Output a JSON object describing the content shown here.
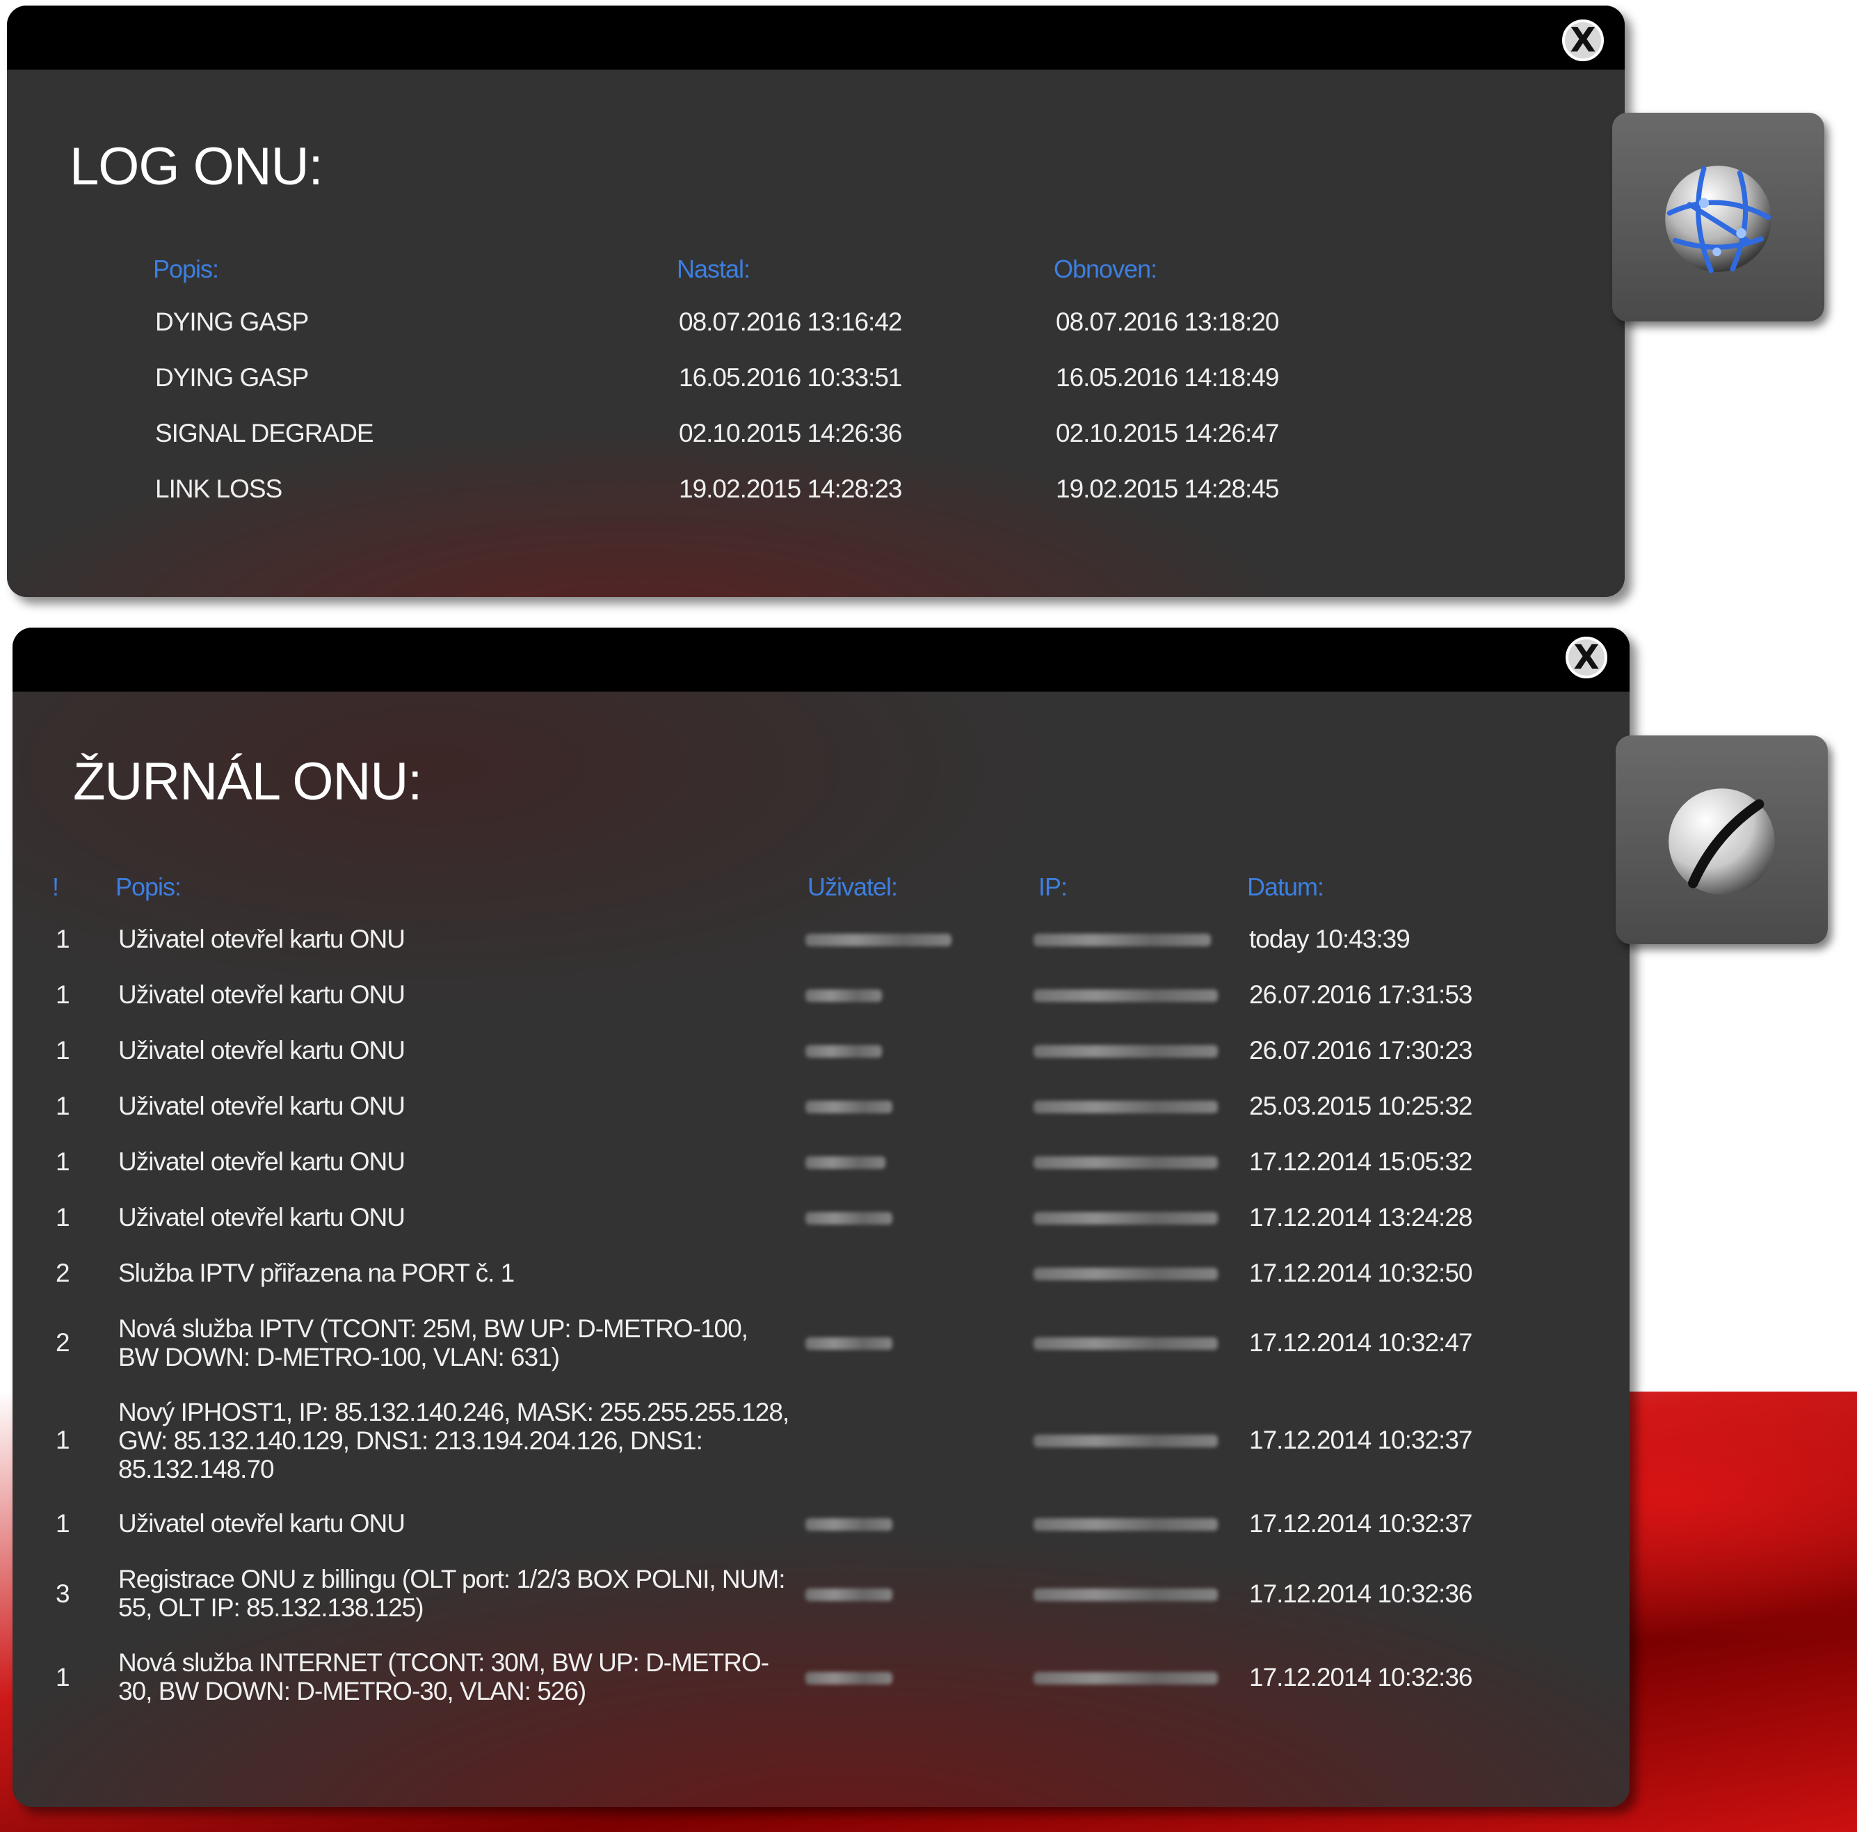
{
  "log_panel": {
    "title": "LOG ONU:",
    "close_label": "X",
    "headers": {
      "popis": "Popis:",
      "nastal": "Nastal:",
      "obnoven": "Obnoven:"
    },
    "rows": [
      {
        "popis": "DYING GASP",
        "nastal": "08.07.2016 13:16:42",
        "obnoven": "08.07.2016 13:18:20"
      },
      {
        "popis": "DYING GASP",
        "nastal": "16.05.2016 10:33:51",
        "obnoven": "16.05.2016 14:18:49"
      },
      {
        "popis": "SIGNAL DEGRADE",
        "nastal": "02.10.2015 14:26:36",
        "obnoven": "02.10.2015 14:26:47"
      },
      {
        "popis": "LINK LOSS",
        "nastal": "19.02.2015 14:28:23",
        "obnoven": "19.02.2015 14:28:45"
      }
    ]
  },
  "journal_panel": {
    "title": "ŽURNÁL ONU:",
    "close_label": "X",
    "headers": {
      "level": "!",
      "popis": "Popis:",
      "uzivatel": "Uživatel:",
      "ip": "IP:",
      "datum": "Datum:"
    },
    "rows": [
      {
        "level": "1",
        "popis": "Uživatel otevřel kartu ONU",
        "datum": "today 10:43:39"
      },
      {
        "level": "1",
        "popis": "Uživatel otevřel kartu ONU",
        "datum": "26.07.2016 17:31:53"
      },
      {
        "level": "1",
        "popis": "Uživatel otevřel kartu ONU",
        "datum": "26.07.2016 17:30:23"
      },
      {
        "level": "1",
        "popis": "Uživatel otevřel kartu ONU",
        "datum": "25.03.2015 10:25:32"
      },
      {
        "level": "1",
        "popis": "Uživatel otevřel kartu ONU",
        "datum": "17.12.2014 15:05:32"
      },
      {
        "level": "1",
        "popis": "Uživatel otevřel kartu ONU",
        "datum": "17.12.2014 13:24:28"
      },
      {
        "level": "2",
        "popis": "Služba IPTV přiřazena na PORT č. 1",
        "datum": "17.12.2014 10:32:50"
      },
      {
        "level": "2",
        "popis_lines": [
          "Nová služba IPTV (TCONT: 25M, BW UP: D-METRO-100,",
          "BW DOWN: D-METRO-100, VLAN: 631)"
        ],
        "datum": "17.12.2014 10:32:47"
      },
      {
        "level": "1",
        "popis_lines": [
          "Nový IPHOST1, IP: 85.132.140.246, MASK: 255.255.255.128,",
          "GW: 85.132.140.129, DNS1: 213.194.204.126, DNS1:",
          "85.132.148.70"
        ],
        "datum": "17.12.2014 10:32:37"
      },
      {
        "level": "1",
        "popis": "Uživatel otevřel kartu ONU",
        "datum": "17.12.2014 10:32:37"
      },
      {
        "level": "3",
        "popis_lines": [
          "Registrace ONU z billingu (OLT port: 1/2/3 BOX POLNI, NUM:",
          "55, OLT IP: 85.132.138.125)"
        ],
        "datum": "17.12.2014 10:32:36"
      },
      {
        "level": "1",
        "popis_lines": [
          "Nová služba INTERNET (TCONT: 30M, BW UP: D-METRO-",
          "30, BW DOWN: D-METRO-30, VLAN: 526)"
        ],
        "datum": "17.12.2014 10:32:36"
      }
    ]
  },
  "icons": {
    "log_tab": "globe-network-icon",
    "journal_tab": "sphere-icon"
  },
  "colors": {
    "header_blue": "#3d7fe0",
    "panel_bg": "#333333",
    "accent_red": "#cc1010"
  }
}
